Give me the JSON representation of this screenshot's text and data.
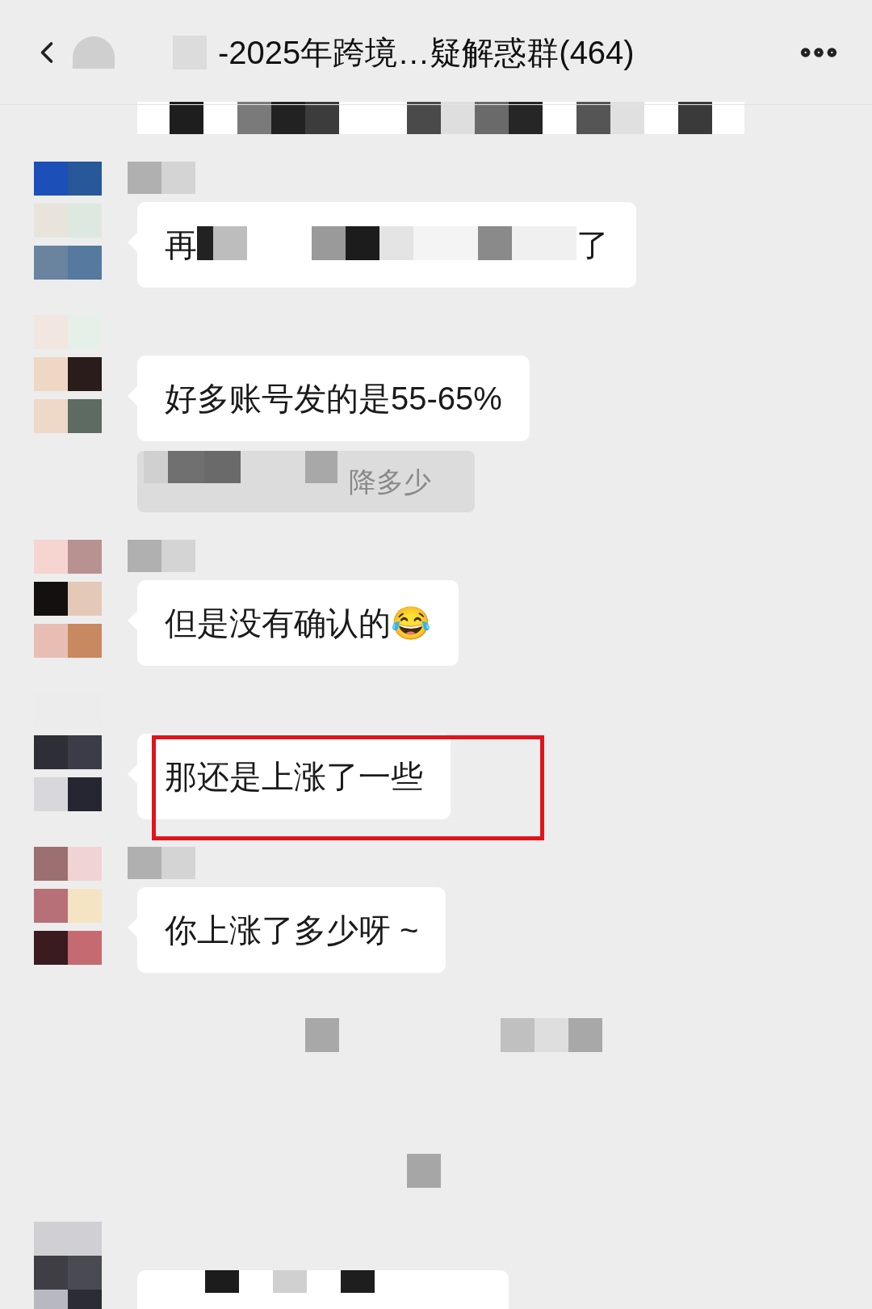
{
  "header": {
    "title": "-2025年跨境…疑解惑群(464)"
  },
  "messages": [
    {
      "kind": "redacted",
      "parts": [
        "再",
        "了"
      ],
      "highlighted": false,
      "named": true
    },
    {
      "kind": "text",
      "text": "好多账号发的是55-65%",
      "highlighted": false,
      "named": false
    },
    {
      "kind": "quote",
      "text": "降多少"
    },
    {
      "kind": "text",
      "text": "但是没有确认的😂",
      "highlighted": false,
      "named": true
    },
    {
      "kind": "text",
      "text": "那还是上涨了一些",
      "highlighted": true,
      "named": false
    },
    {
      "kind": "text",
      "text": "你上涨了多少呀 ~",
      "highlighted": false,
      "named": true
    }
  ]
}
